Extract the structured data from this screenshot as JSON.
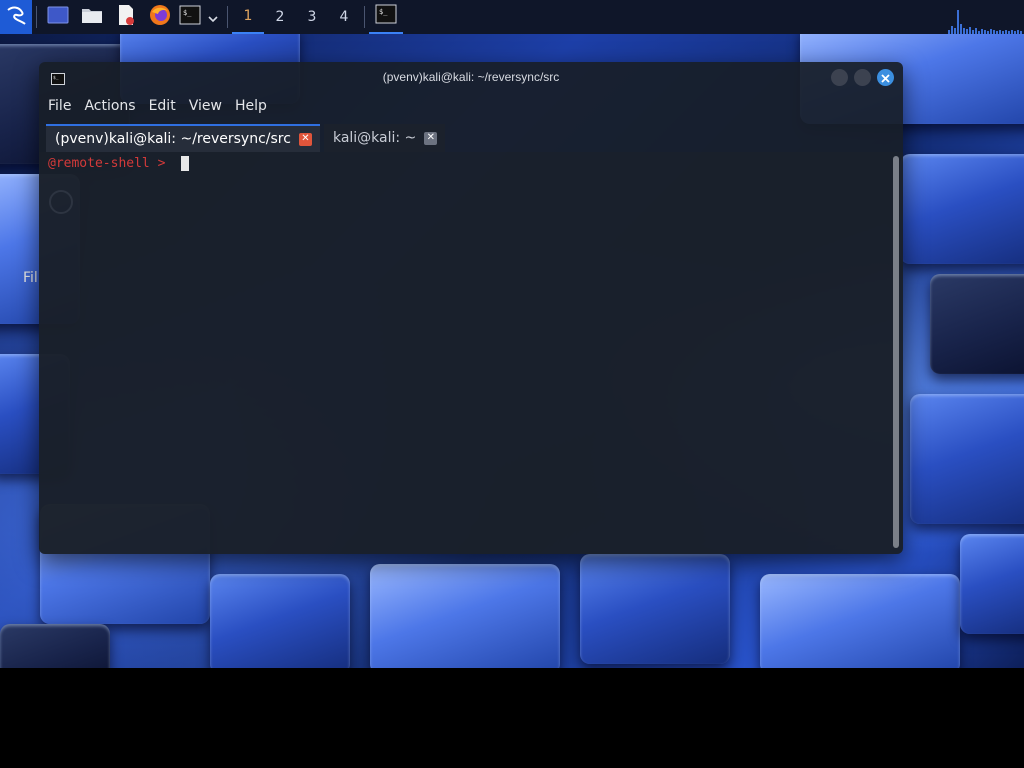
{
  "panel": {
    "launchers": [
      {
        "name": "kali-menu-icon"
      },
      {
        "name": "show-desktop-icon"
      },
      {
        "name": "file-manager-icon"
      },
      {
        "name": "text-editor-icon"
      },
      {
        "name": "firefox-icon"
      },
      {
        "name": "terminal-icon"
      }
    ],
    "workspaces": [
      "1",
      "2",
      "3",
      "4"
    ],
    "active_workspace": "1",
    "accent_color": "#3b82f6"
  },
  "desktop": {
    "file_label": "Fil"
  },
  "terminal": {
    "title": "(pvenv)kali@kali: ~/reversync/src",
    "menu": [
      "File",
      "Actions",
      "Edit",
      "View",
      "Help"
    ],
    "tabs": [
      {
        "label": "(pvenv)kali@kali: ~/reversync/src",
        "active": true
      },
      {
        "label": "kali@kali: ~",
        "active": false
      }
    ],
    "prompt": "@remote-shell > ",
    "prompt_color": "#d33a3a",
    "close_button_color": "#3b8fe0"
  }
}
